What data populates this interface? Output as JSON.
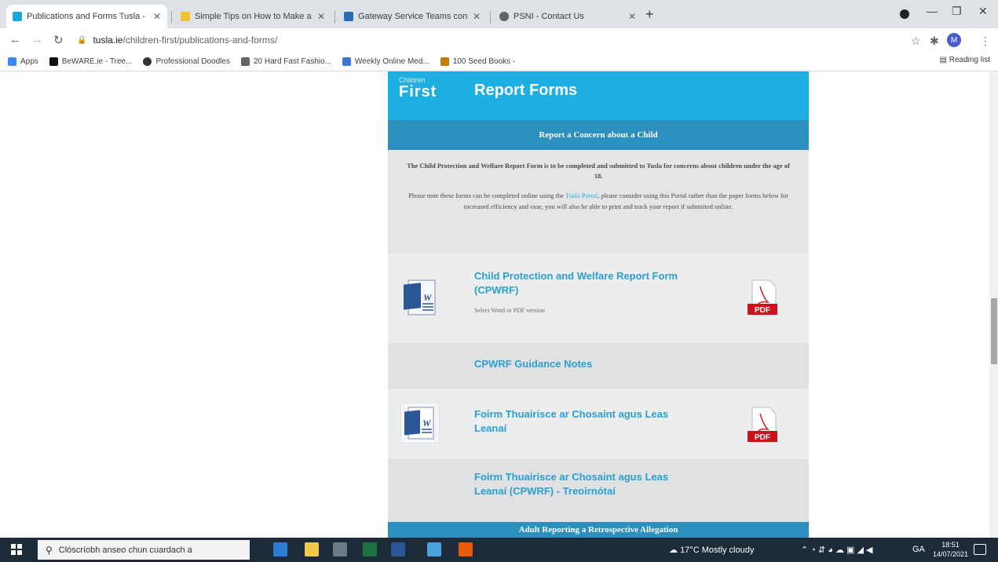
{
  "browser": {
    "tabs": [
      {
        "title": "Publications and Forms Tusla - U",
        "active": true,
        "favicon_color": "#1aa5d8"
      },
      {
        "title": "Simple Tips on How to Make a",
        "active": false,
        "favicon_color": "#f1c232"
      },
      {
        "title": "Gateway Service Teams contact",
        "active": false,
        "favicon_color": "#2b6cb0"
      },
      {
        "title": "PSNI - Contact Us",
        "active": false,
        "favicon_color": "#5f6368"
      }
    ],
    "new_tab": "+",
    "window_controls": {
      "minimize": "—",
      "maximize": "❐",
      "close": "✕"
    },
    "url_host": "tusla.ie",
    "url_path": "/children-first/publications-and-forms/",
    "avatar_letter": "M",
    "bookmarks": [
      {
        "label": "Apps",
        "color": "#4285f4"
      },
      {
        "label": "BeWARE.ie - Tree...",
        "color": "#111111"
      },
      {
        "label": "Professional Doodles",
        "color": "#333333"
      },
      {
        "label": "20 Hard Fast Fashio...",
        "color": "#666666"
      },
      {
        "label": "Weekly Online Med...",
        "color": "#3c78d8"
      },
      {
        "label": "100 Seed Books -",
        "color": "#c27c0e"
      }
    ],
    "reading_list": "Reading list"
  },
  "page": {
    "logo_line1": "Children",
    "logo_line2": "First",
    "title": "Report Forms",
    "section_header": "Report a Concern about a Child",
    "intro_p1": "The Child Protection and Welfare Report Form is to be completed and submitted to Tusla for concerns about children under the age of 18.",
    "intro_p2_a": "Please note these forms can be completed online using the ",
    "intro_p2_link": "Tusla Portal",
    "intro_p2_b": ", please consider using this Portal rather than the paper forms below for increased efficiency and ease, you will also be able to print and track your report if submitted online.",
    "items": [
      {
        "title": "Child Protection and Welfare Report Form (CPWRF)",
        "subtitle": "Select Word or PDF version",
        "pdf_label": "PDF"
      },
      {
        "title": "CPWRF Guidance Notes"
      },
      {
        "title": "Foirm Thuairisce ar Chosaint agus Leas Leanaí",
        "pdf_label": "PDF"
      },
      {
        "title": "Foirm Thuairisce ar Chosaint agus Leas Leanaí (CPWRF) - Treoirnótaí"
      }
    ],
    "bottom_header": "Adult Reporting a Retrospective Allegation"
  },
  "taskbar": {
    "search_placeholder": "Clóscríobh anseo chun cuardach a",
    "weather": "17°C Mostly cloudy",
    "lang": "GA",
    "time": "18:51",
    "date": "14/07/2021"
  },
  "colors": {
    "brand": "#1daee2",
    "band": "#2c8fbd",
    "link": "#2a9fd1"
  }
}
